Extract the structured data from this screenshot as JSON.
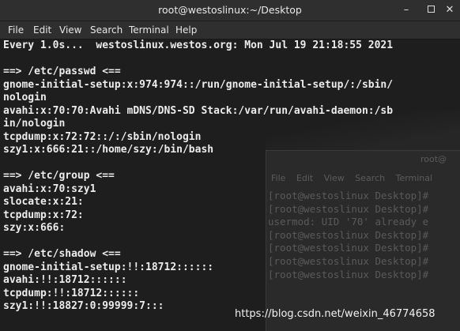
{
  "window": {
    "title": "root@westoslinux:~/Desktop",
    "minimize_glyph": "–",
    "close_glyph": "✕"
  },
  "menubar": [
    "File",
    "Edit",
    "View",
    "Search",
    "Terminal",
    "Help"
  ],
  "terminal_lines": [
    "Every 1.0s...  westoslinux.westos.org: Mon Jul 19 21:18:55 2021",
    "",
    "==> /etc/passwd <==",
    "gnome-initial-setup:x:974:974::/run/gnome-initial-setup/:/sbin/",
    "nologin",
    "avahi:x:70:70:Avahi mDNS/DNS-SD Stack:/var/run/avahi-daemon:/sb",
    "in/nologin",
    "tcpdump:x:72:72::/:/sbin/nologin",
    "szy1:x:666:21::/home/szy:/bin/bash",
    "",
    "==> /etc/group <==",
    "avahi:x:70:szy1",
    "slocate:x:21:",
    "tcpdump:x:72:",
    "szy:x:666:",
    "",
    "==> /etc/shadow <==",
    "gnome-initial-setup:!!:18712::::::",
    "avahi:!!:18712::::::",
    "tcpdump:!!:18712::::::",
    "szy1:!!:18827:0:99999:7:::"
  ],
  "background_window": {
    "title": "root@",
    "menu": "File Edit View Search Terminal",
    "lines": [
      "[root@westoslinux Desktop]#",
      "[root@westoslinux Desktop]#",
      "usermod: UID '70' already e",
      "[root@westoslinux Desktop]#",
      "[root@westoslinux Desktop]#",
      "[root@westoslinux Desktop]#",
      "[root@westoslinux Desktop]#"
    ]
  },
  "watermark": "https://blog.csdn.net/weixin_46774658"
}
